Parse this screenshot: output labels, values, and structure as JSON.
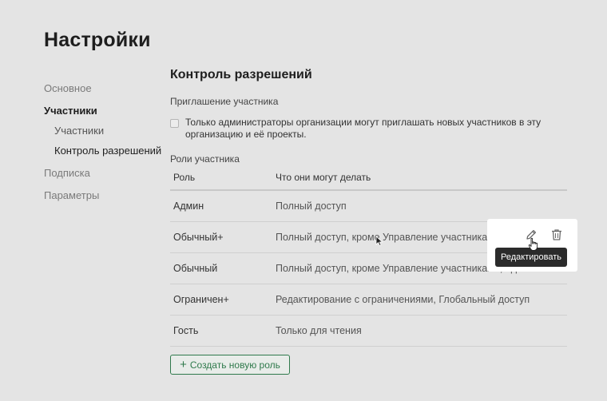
{
  "page": {
    "title": "Настройки"
  },
  "sidebar": {
    "items": [
      {
        "label": "Основное"
      },
      {
        "label": "Участники"
      },
      {
        "label": "Участники"
      },
      {
        "label": "Контроль разрешений"
      },
      {
        "label": "Подписка"
      },
      {
        "label": "Параметры"
      }
    ]
  },
  "main": {
    "title": "Контроль разрешений",
    "invite_label": "Приглашение участника",
    "checkbox_text": "Только администраторы организации могут приглашать новых участников в эту организацию и её проекты.",
    "checkbox_checked": false,
    "roles_label": "Роли участника",
    "columns": {
      "role": "Роль",
      "perms": "Что они могут делать"
    },
    "rows": [
      {
        "role": "Админ",
        "perms": "Полный доступ"
      },
      {
        "role": "Обычный+",
        "perms": "Полный доступ, кроме Управление участниками..."
      },
      {
        "role": "Обычный",
        "perms": "Полный доступ, кроме Управление участниками, Удалени..."
      },
      {
        "role": "Ограничен+",
        "perms": "Редактирование с ограничениями, Глобальный доступ"
      },
      {
        "role": "Гость",
        "perms": "Только для чтения"
      }
    ],
    "create_button": {
      "icon": "+",
      "label": "Создать новую роль"
    }
  },
  "row_actions": {
    "edit_icon": "pencil-icon",
    "delete_icon": "trash-icon",
    "tooltip": "Редактировать"
  },
  "colors": {
    "accent": "#2f7a4c",
    "background": "#e4e4e4",
    "tooltip_bg": "#2b2b2b"
  }
}
